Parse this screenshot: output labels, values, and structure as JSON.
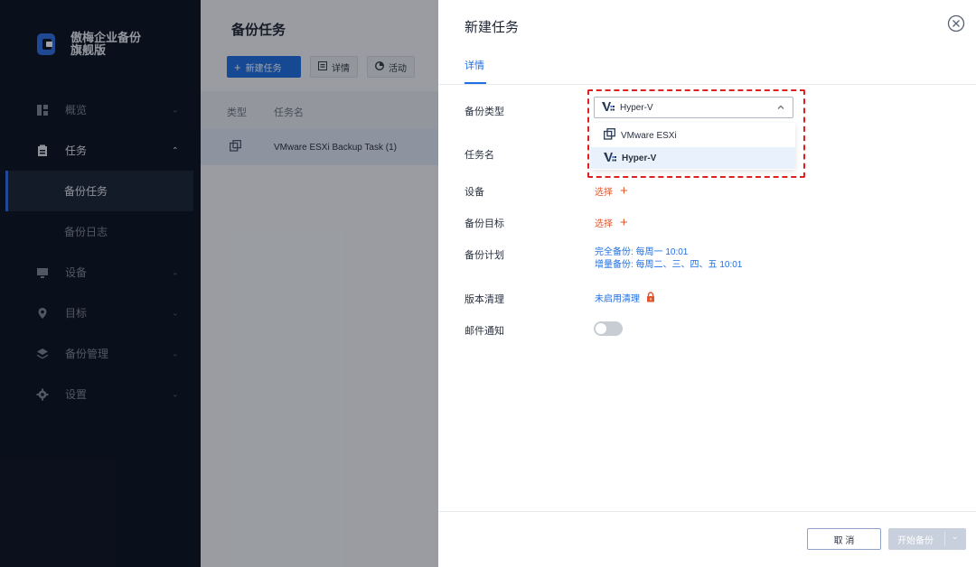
{
  "app": {
    "brand": "傲梅企业备份旗舰版"
  },
  "sidebar": {
    "items": [
      {
        "label": "概览",
        "icon": "dashboard-icon"
      },
      {
        "label": "任务",
        "icon": "clipboard-icon"
      },
      {
        "label": "备份任务"
      },
      {
        "label": "备份日志"
      },
      {
        "label": "设备",
        "icon": "monitor-icon"
      },
      {
        "label": "目标",
        "icon": "location-pin-icon"
      },
      {
        "label": "备份管理",
        "icon": "layers-icon"
      },
      {
        "label": "设置",
        "icon": "gear-icon"
      }
    ]
  },
  "main": {
    "title": "备份任务",
    "toolbar": {
      "new_task": "新建任务",
      "details": "详情",
      "activity": "活动"
    },
    "table": {
      "headers": [
        "类型",
        "任务名"
      ],
      "rows": [
        {
          "name": "VMware ESXi Backup Task (1)"
        }
      ]
    }
  },
  "drawer": {
    "title": "新建任务",
    "tab": "详情",
    "fields": {
      "backup_type": "备份类型",
      "task_name": "任务名",
      "device": "设备",
      "target": "备份目标",
      "schedule": "备份计划",
      "version_cleanup": "版本清理",
      "email": "邮件通知"
    },
    "select_value": "Hyper-V",
    "options": [
      "VMware ESXi",
      "Hyper-V"
    ],
    "device_link": "选择",
    "target_link": "选择",
    "schedule_line1": "完全备份: 每周一 10:01",
    "schedule_line2": "增量备份: 每周二、三、四、五 10:01",
    "cleanup_text": "未启用清理",
    "email_enabled": false,
    "cancel": "取 消",
    "start": "开始备份"
  },
  "colors": {
    "primary": "#1e6fe3",
    "sidebar_bg": "#0b1220",
    "link_red": "#e4542b",
    "highlight_dash": "#e02020"
  }
}
